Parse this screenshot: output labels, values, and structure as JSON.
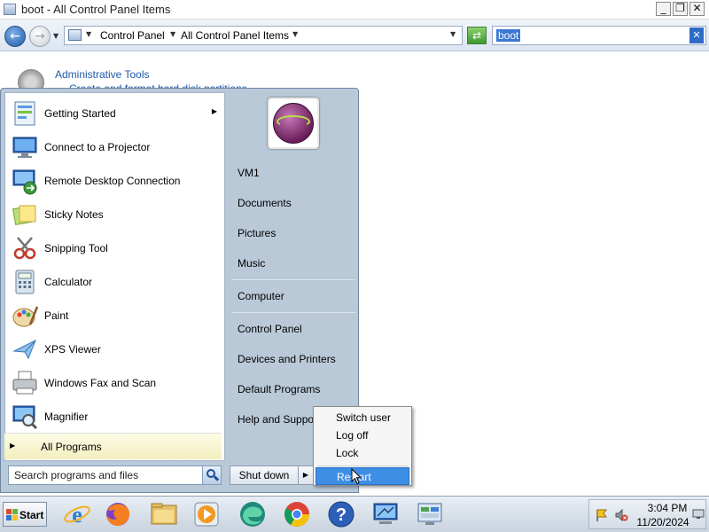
{
  "window": {
    "title": "boot - All Control Panel Items",
    "minimize_glyph": "_",
    "restore_glyph": "❐",
    "close_glyph": "✕"
  },
  "address": {
    "crumbs": [
      "Control Panel",
      "All Control Panel Items"
    ],
    "search_query": "boot"
  },
  "content": {
    "item_title": "Administrative Tools",
    "item_desc": "Create and format hard disk partitions"
  },
  "start_menu": {
    "programs": [
      {
        "label": "Getting Started",
        "icon": "getting-started-icon",
        "submenu": true
      },
      {
        "label": "Connect to a Projector",
        "icon": "projector-icon"
      },
      {
        "label": "Remote Desktop Connection",
        "icon": "remote-desktop-icon"
      },
      {
        "label": "Sticky Notes",
        "icon": "sticky-notes-icon"
      },
      {
        "label": "Snipping Tool",
        "icon": "snipping-tool-icon"
      },
      {
        "label": "Calculator",
        "icon": "calculator-icon"
      },
      {
        "label": "Paint",
        "icon": "paint-icon"
      },
      {
        "label": "XPS Viewer",
        "icon": "xps-viewer-icon"
      },
      {
        "label": "Windows Fax and Scan",
        "icon": "fax-scan-icon"
      },
      {
        "label": "Magnifier",
        "icon": "magnifier-icon"
      }
    ],
    "all_programs": "All Programs",
    "search_placeholder": "Search programs and files",
    "right_items": {
      "user": "VM1",
      "documents": "Documents",
      "pictures": "Pictures",
      "music": "Music",
      "computer": "Computer",
      "control_panel": "Control Panel",
      "devices": "Devices and Printers",
      "default_programs": "Default Programs",
      "help": "Help and Suppo"
    },
    "shutdown_label": "Shut down"
  },
  "shutdown_submenu": {
    "items": [
      "Switch user",
      "Log off",
      "Lock",
      "Restart"
    ],
    "active_index": 3
  },
  "taskbar": {
    "start_label": "Start",
    "pinned": [
      "internet-explorer-icon",
      "firefox-icon",
      "file-explorer-icon",
      "media-player-icon",
      "edge-icon",
      "chrome-icon",
      "help-icon",
      "remote-desktop-icon",
      "control-panel-icon"
    ],
    "time": "3:04 PM",
    "date": "11/20/2024"
  },
  "colors": {
    "accent": "#3e8ee5",
    "link": "#1e5aa8",
    "menu_frame": "#b9c9d8"
  }
}
